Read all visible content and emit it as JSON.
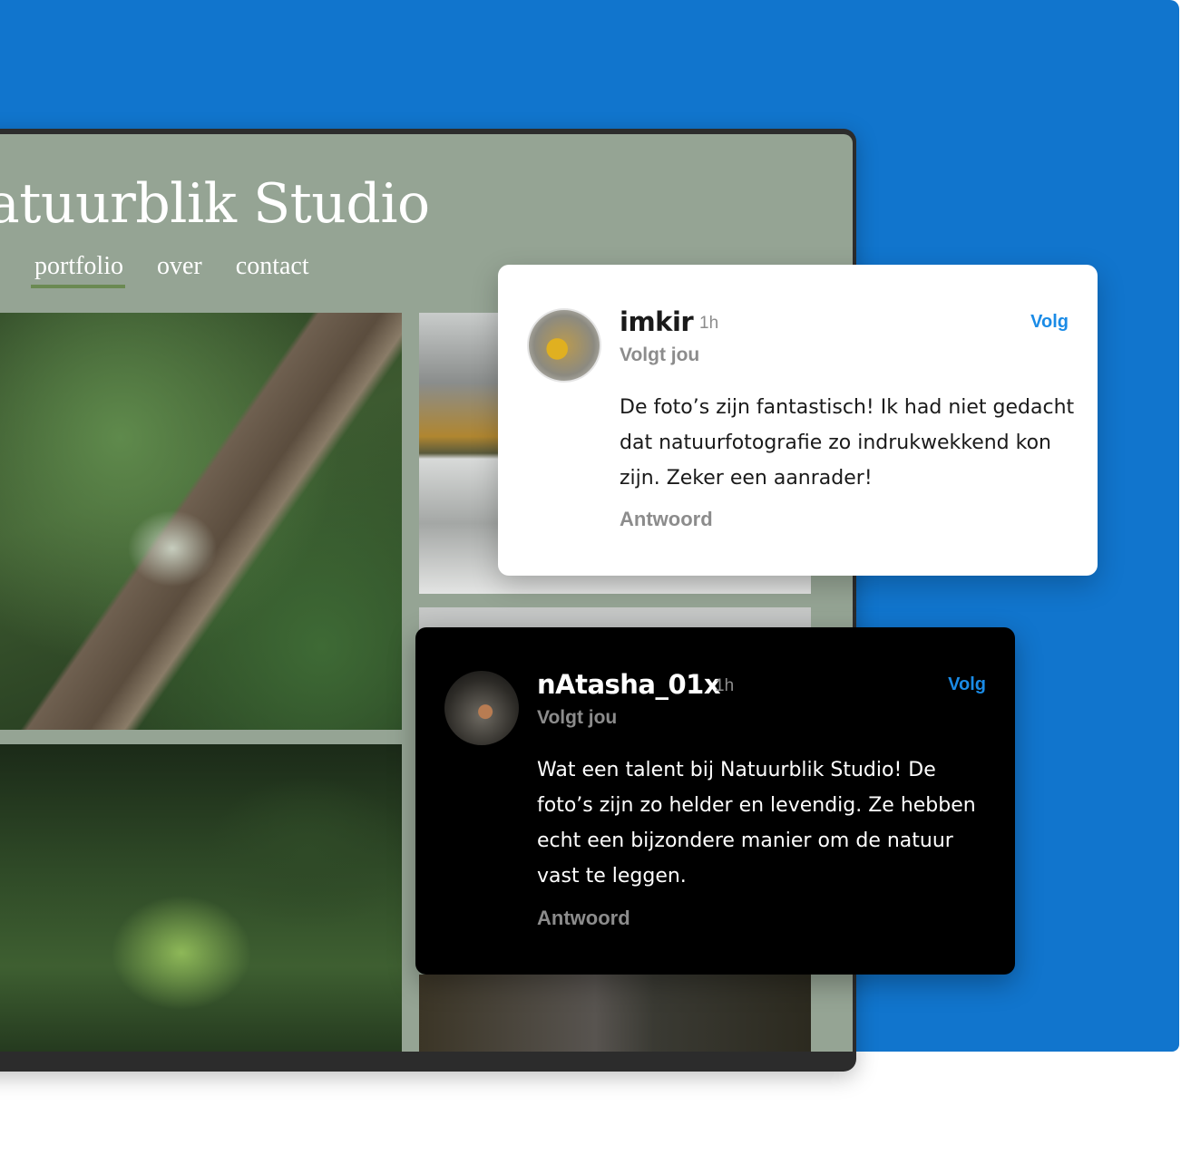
{
  "site": {
    "title": "atuurblik Studio",
    "nav": [
      "portfolio",
      "over",
      "contact"
    ],
    "active_nav": "portfolio"
  },
  "comments": [
    {
      "username": "imkir",
      "time": "1h",
      "follow_label": "Volg",
      "follows_you": "Volgt jou",
      "text": "De foto’s zijn fantastisch! Ik had niet gedacht dat natuurfotografie zo indrukwekkend kon zijn. Zeker een aanrader!",
      "reply_label": "Antwoord",
      "theme": "light"
    },
    {
      "username": "nAtasha_01x",
      "time": "1h",
      "follow_label": "Volg",
      "follows_you": "Volgt jou",
      "text": "Wat een talent bij Natuurblik Studio! De foto’s zijn zo helder en levendig. Ze hebben echt een bijzondere manier om de natuur vast te leggen.",
      "reply_label": "Antwoord",
      "theme": "dark"
    }
  ],
  "colors": {
    "background": "#1175cd",
    "site_background": "#95a494",
    "nav_underline": "#6b8a52",
    "follow_link": "#1a8be6"
  }
}
